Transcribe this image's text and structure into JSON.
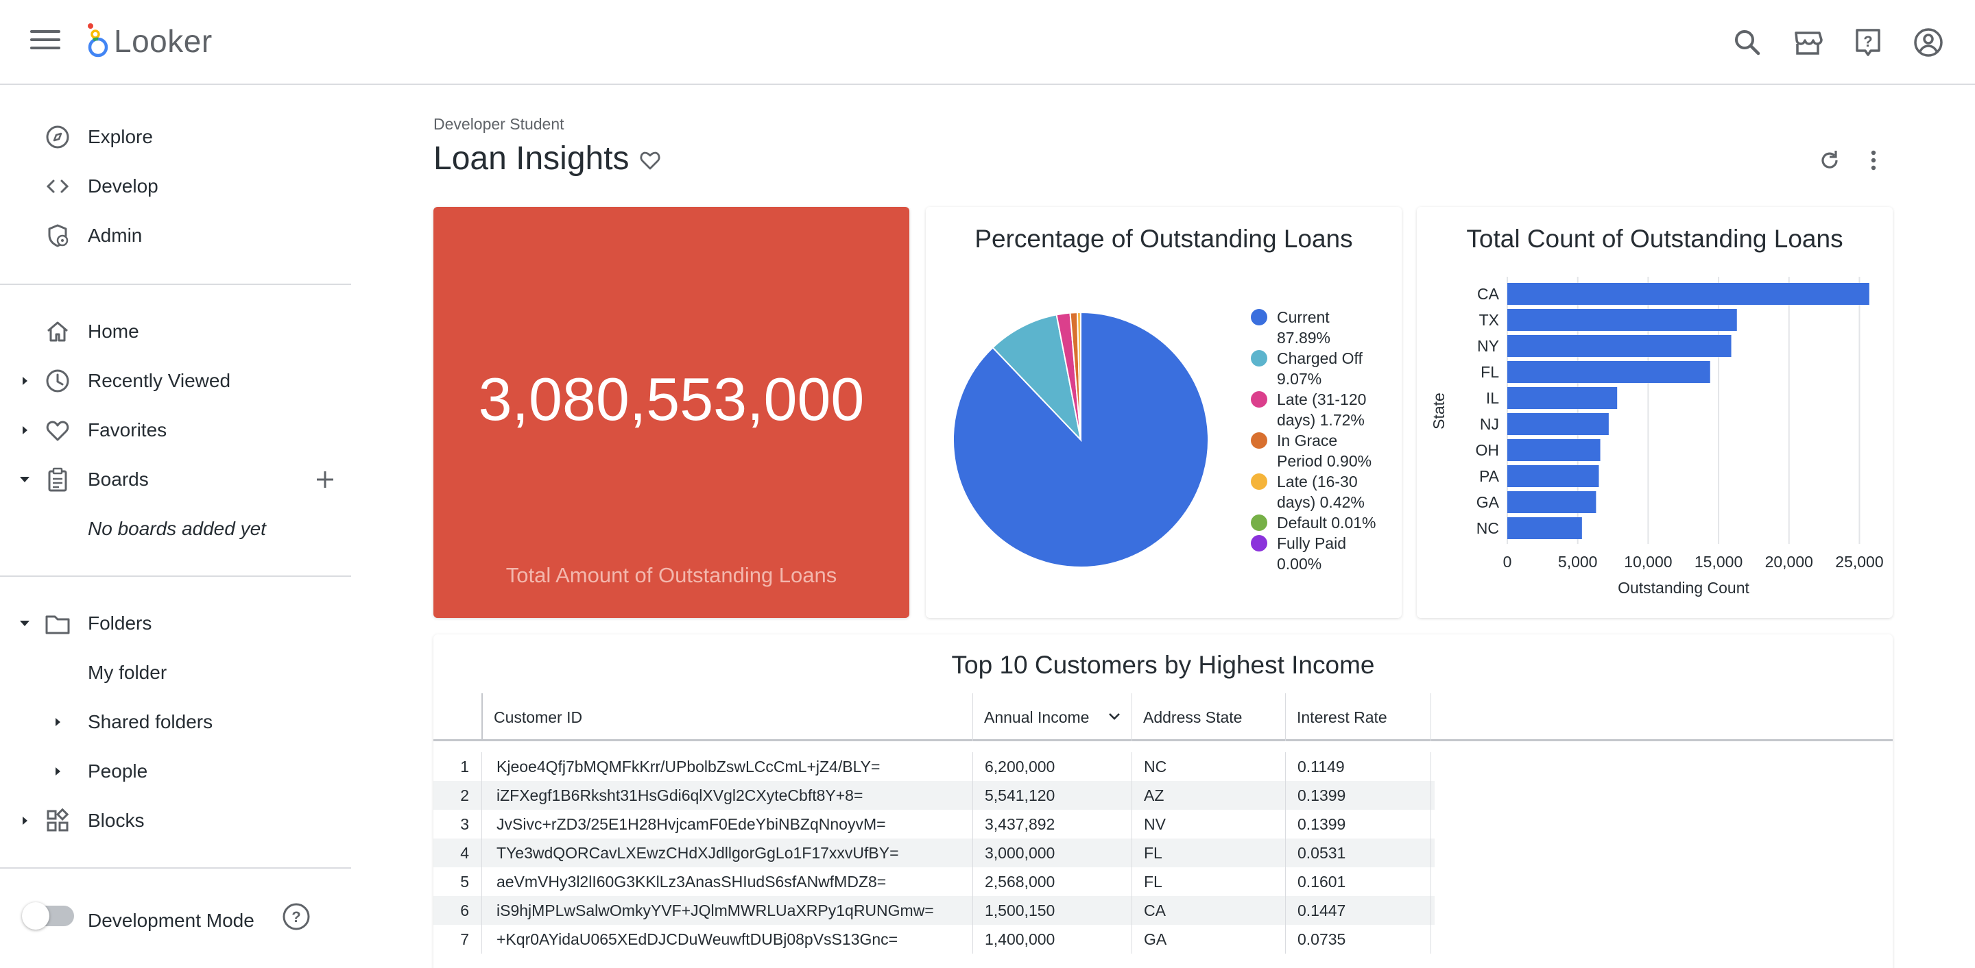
{
  "brand": {
    "name": "Looker"
  },
  "sidebar": {
    "explore": "Explore",
    "develop": "Develop",
    "admin": "Admin",
    "home": "Home",
    "recently_viewed": "Recently Viewed",
    "favorites": "Favorites",
    "boards": "Boards",
    "no_boards": "No boards added yet",
    "folders": "Folders",
    "my_folder": "My folder",
    "shared_folders": "Shared folders",
    "people": "People",
    "blocks": "Blocks",
    "dev_mode": "Development Mode"
  },
  "dashboard": {
    "breadcrumb": "Developer Student",
    "title": "Loan Insights"
  },
  "kpi": {
    "value": "3,080,553,000",
    "label": "Total Amount of Outstanding Loans",
    "color": "#d95140"
  },
  "pie": {
    "title": "Percentage of Outstanding Loans",
    "legend": [
      {
        "line1": "Current",
        "line2": "87.89%"
      },
      {
        "line1": "Charged Off",
        "line2": "9.07%"
      },
      {
        "line1": "Late (31-120",
        "line2": "days) 1.72%"
      },
      {
        "line1": "In Grace",
        "line2": "Period 0.90%"
      },
      {
        "line1": "Late (16-30",
        "line2": "days) 0.42%"
      },
      {
        "line1": "Default 0.01%",
        "line2": ""
      },
      {
        "line1": "Fully Paid",
        "line2": "0.00%"
      }
    ]
  },
  "bar": {
    "title": "Total Count of Outstanding Loans",
    "xlabel": "Outstanding Count",
    "ylabel": "State"
  },
  "chart_data": [
    {
      "type": "pie",
      "title": "Percentage of Outstanding Loans",
      "categories": [
        "Current",
        "Charged Off",
        "Late (31-120 days)",
        "In Grace Period",
        "Late (16-30 days)",
        "Default",
        "Fully Paid"
      ],
      "values": [
        87.89,
        9.07,
        1.72,
        0.9,
        0.42,
        0.01,
        0.0
      ],
      "colors": [
        "#3a6fde",
        "#5cb4cd",
        "#db3f8c",
        "#d8702f",
        "#f5b43a",
        "#76b047",
        "#8b33db"
      ],
      "legend": "right"
    },
    {
      "type": "bar",
      "orientation": "horizontal",
      "title": "Total Count of Outstanding Loans",
      "xlabel": "Outstanding Count",
      "ylabel": "State",
      "categories": [
        "CA",
        "TX",
        "NY",
        "FL",
        "IL",
        "NJ",
        "OH",
        "PA",
        "GA",
        "NC"
      ],
      "values": [
        25700,
        16300,
        15900,
        14400,
        7800,
        7200,
        6600,
        6500,
        6300,
        5300
      ],
      "xlim": [
        0,
        26000
      ],
      "xticks": [
        "0",
        "5,000",
        "10,000",
        "15,000",
        "20,000",
        "25,000"
      ],
      "grid": true,
      "color": "#3a6fde"
    }
  ],
  "table": {
    "title": "Top 10 Customers by Highest Income",
    "columns": [
      "Customer ID",
      "Annual Income",
      "Address State",
      "Interest Rate"
    ],
    "rows": [
      [
        "1",
        "Kjeoe4Qfj7bMQMFkKrr/UPbolbZswLCcCmL+jZ4/BLY=",
        "6,200,000",
        "NC",
        "0.1149"
      ],
      [
        "2",
        "iZFXegf1B6Rksht31HsGdi6qlXVgl2CXyteCbft8Y+8=",
        "5,541,120",
        "AZ",
        "0.1399"
      ],
      [
        "3",
        "JvSivc+rZD3/25E1H28HvjcamF0EdeYbiNBZqNnoyvM=",
        "3,437,892",
        "NV",
        "0.1399"
      ],
      [
        "4",
        "TYe3wdQORCavLXEwzCHdXJdllgorGgLo1F17xxvUfBY=",
        "3,000,000",
        "FL",
        "0.0531"
      ],
      [
        "5",
        "aeVmVHy3l2lI60G3KKlLz3AnasSHIudS6sfANwfMDZ8=",
        "2,568,000",
        "FL",
        "0.1601"
      ],
      [
        "6",
        "iS9hjMPLwSalwOmkyYVF+JQlmMWRLUaXRPy1qRUNGmw=",
        "1,500,150",
        "CA",
        "0.1447"
      ],
      [
        "7",
        "+Kqr0AYidaU065XEdDJCDuWeuwftDUBj08pVsS13Gnc=",
        "1,400,000",
        "GA",
        "0.0735"
      ]
    ]
  }
}
